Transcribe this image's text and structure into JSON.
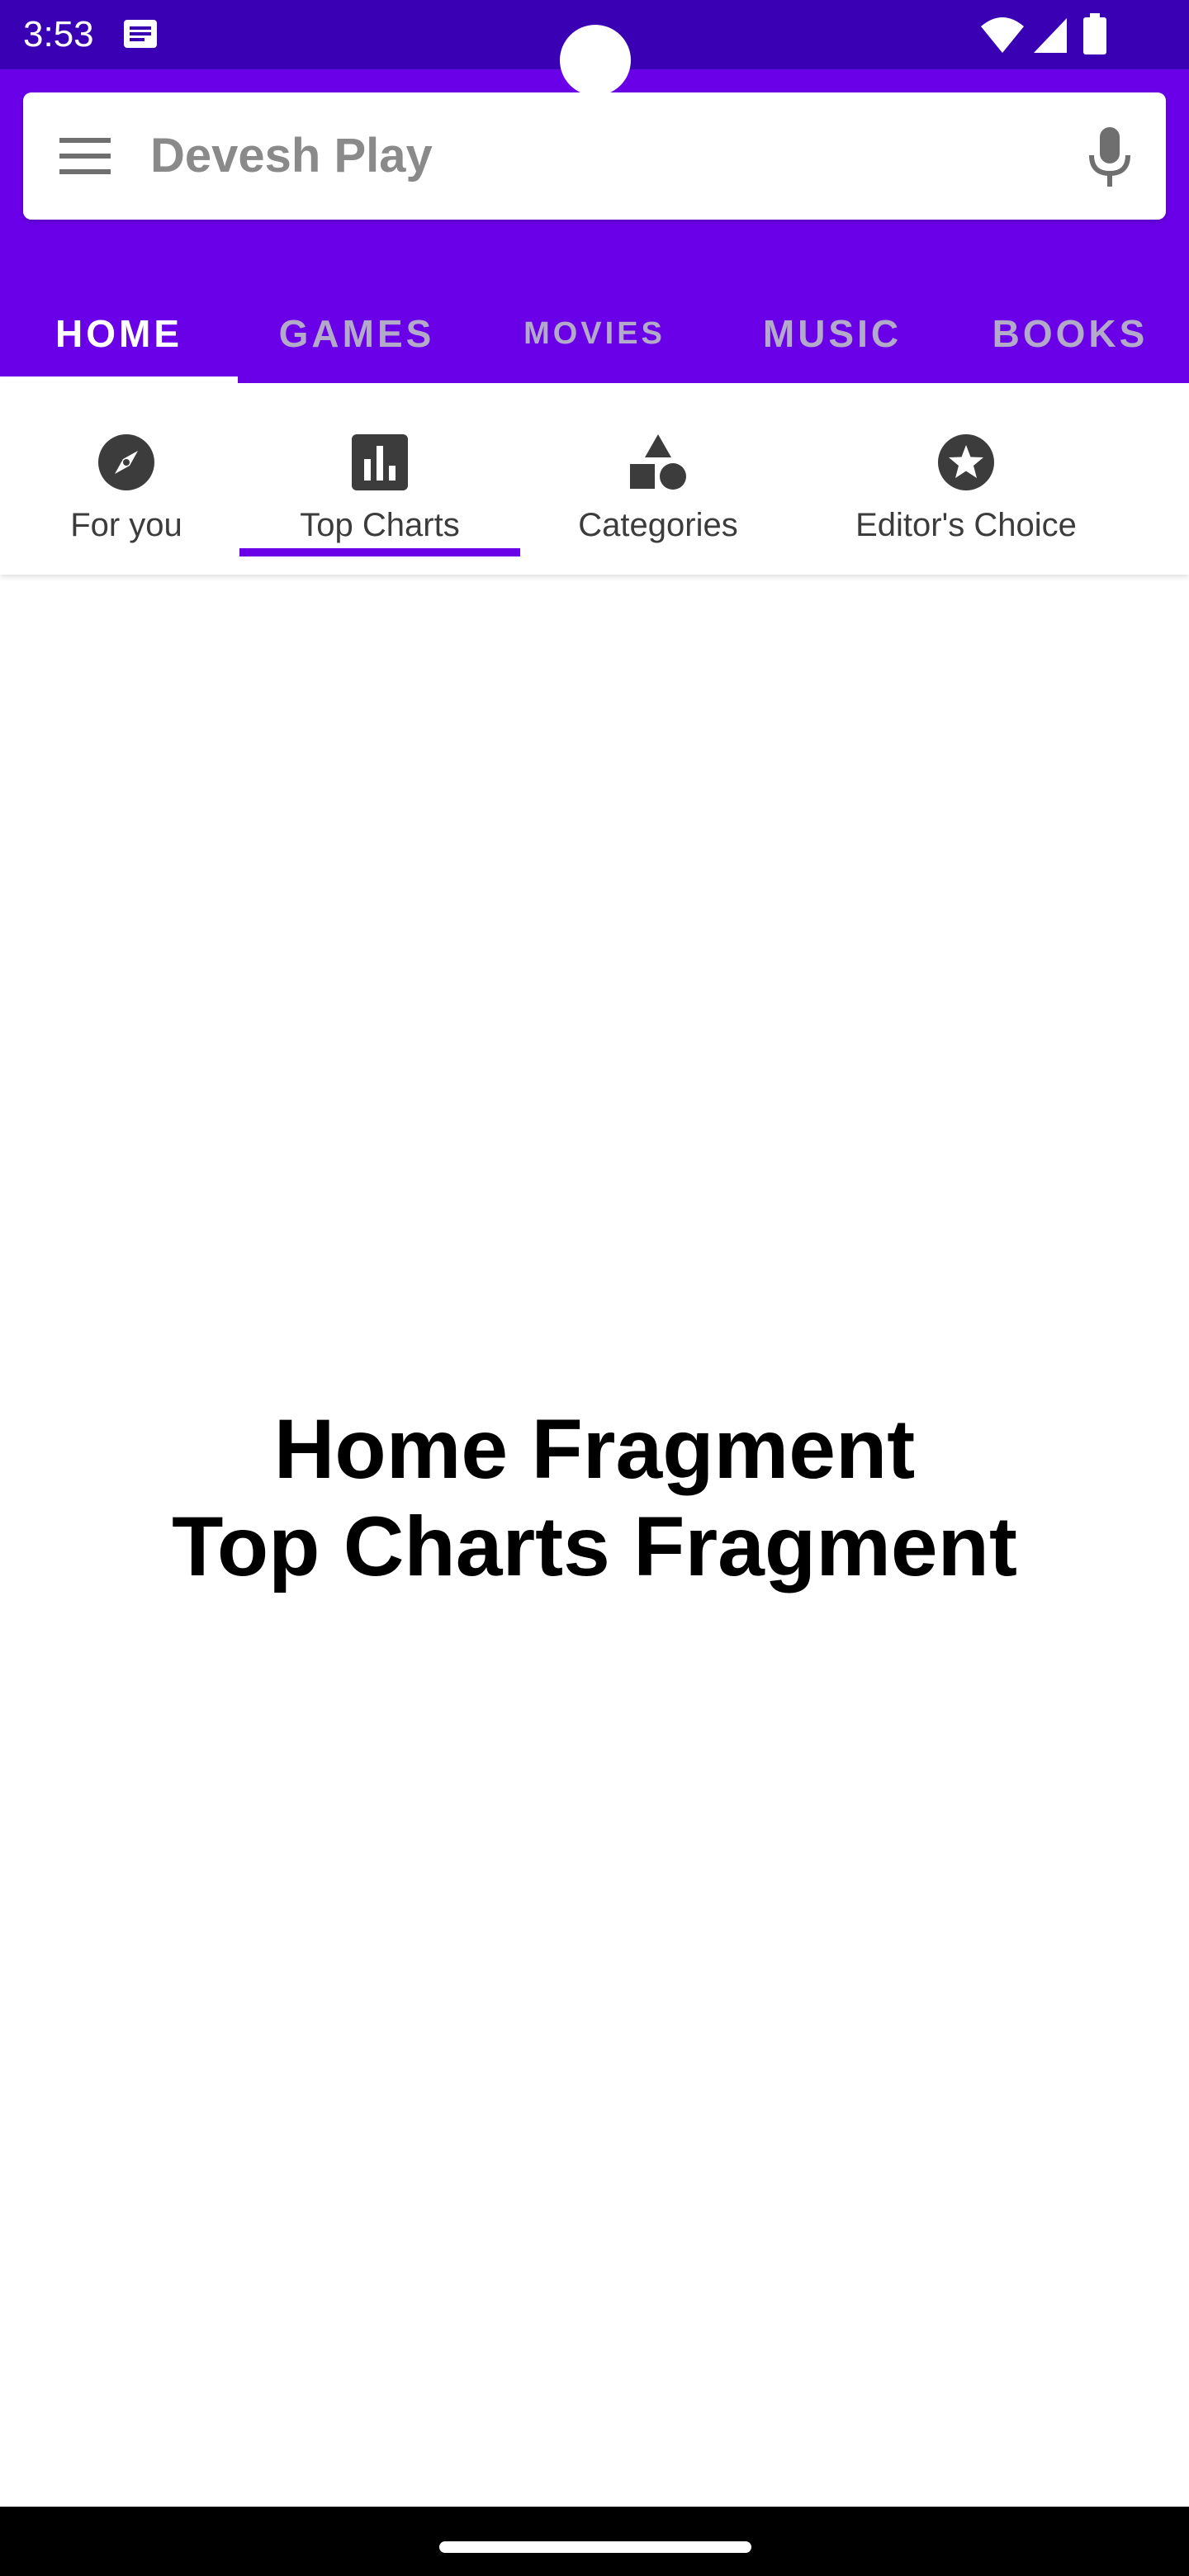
{
  "status_bar": {
    "time": "3:53",
    "icons": [
      "message-icon",
      "wifi-icon",
      "signal-icon",
      "battery-icon"
    ]
  },
  "header": {
    "search_placeholder": "Devesh Play",
    "menu_icon": "hamburger-menu-icon",
    "mic_icon": "microphone-icon"
  },
  "main_tabs": [
    {
      "label": "HOME",
      "active": true
    },
    {
      "label": "GAMES",
      "active": false
    },
    {
      "label": "MOVIES",
      "active": false
    },
    {
      "label": "MUSIC",
      "active": false
    },
    {
      "label": "BOOKS",
      "active": false
    }
  ],
  "sub_tabs": [
    {
      "label": "For you",
      "icon": "compass-icon",
      "active": false
    },
    {
      "label": "Top Charts",
      "icon": "bar-chart-icon",
      "active": true
    },
    {
      "label": "Categories",
      "icon": "shapes-icon",
      "active": false
    },
    {
      "label": "Editor's Choice",
      "icon": "star-icon",
      "active": false
    }
  ],
  "content": {
    "line1": "Home Fragment",
    "line2": "Top Charts Fragment"
  },
  "colors": {
    "status_bar": "#3a00b4",
    "primary": "#6a00e8",
    "inactive_tab_text": "#b3a9c8",
    "sub_tab_text": "#3c3c3c"
  }
}
